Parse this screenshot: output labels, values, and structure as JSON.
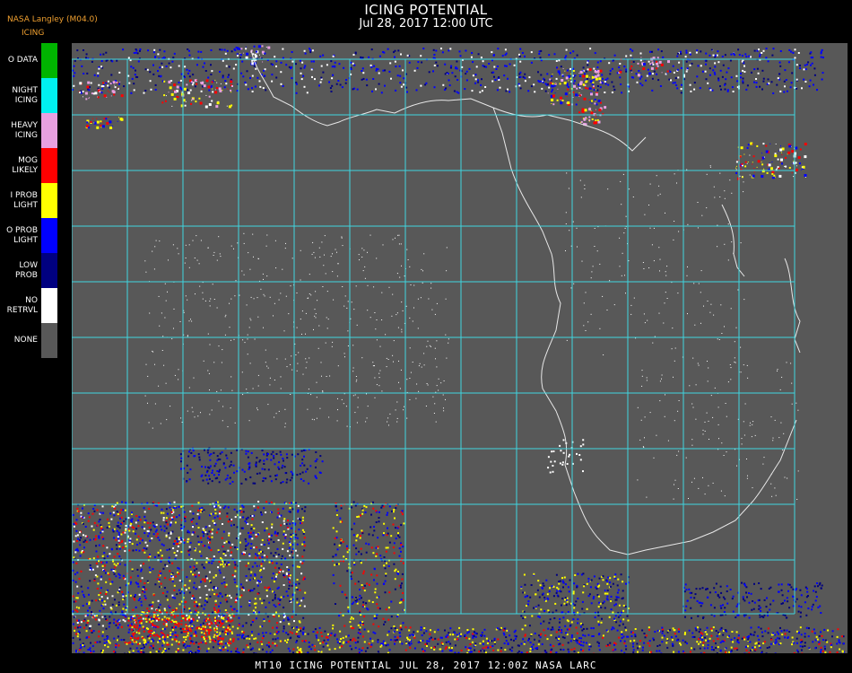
{
  "header": {
    "title": "ICING POTENTIAL",
    "subtitle": "Jul 28, 2017 12:00 UTC",
    "credit": "NASA Langley (M04.0)",
    "legend_title": "ICING"
  },
  "legend": [
    {
      "lines": [
        "O DATA"
      ],
      "color": "#00b400"
    },
    {
      "lines": [
        "NIGHT",
        "ICING"
      ],
      "color": "#00f0f0"
    },
    {
      "lines": [
        "HEAVY",
        "ICING"
      ],
      "color": "#e8a0e0"
    },
    {
      "lines": [
        "MOG",
        "LIKELY"
      ],
      "color": "#ff0000"
    },
    {
      "lines": [
        "I PROB",
        "LIGHT"
      ],
      "color": "#ffff00"
    },
    {
      "lines": [
        "O PROB",
        "LIGHT"
      ],
      "color": "#0000ff"
    },
    {
      "lines": [
        "LOW",
        "PROB"
      ],
      "color": "#000080"
    },
    {
      "lines": [
        "NO",
        "RETRVL"
      ],
      "color": "#ffffff"
    },
    {
      "lines": [
        "NONE"
      ],
      "color": "#585858"
    }
  ],
  "map": {
    "background_color": "#585858",
    "gridline_color": "#3fd6e0",
    "coast_color": "#e8e8e8",
    "grid_label_color": "#d83030"
  },
  "footer": "MT10  ICING POTENTIAL   JUL 28, 2017 12:00Z  NASA LARC"
}
